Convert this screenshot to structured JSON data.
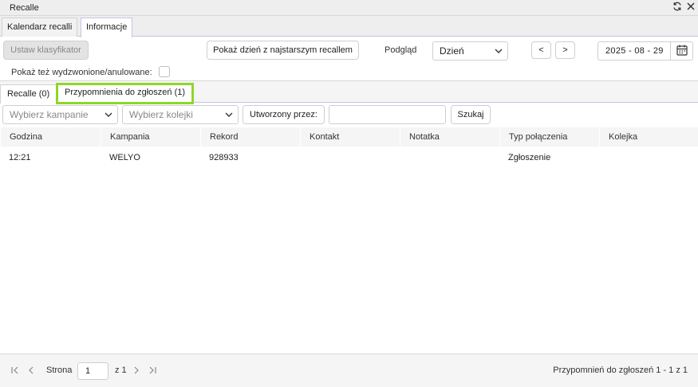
{
  "window": {
    "title": "Recalle",
    "refresh_icon": "refresh-icon",
    "close_icon": "close-icon"
  },
  "top_tabs": [
    {
      "label": "Kalendarz recalli",
      "active": false
    },
    {
      "label": "Informacje",
      "active": true
    }
  ],
  "toolbar": {
    "set_classifier_label": "Ustaw klasyfikator",
    "show_oldest_label": "Pokaż dzień z najstarszym recallem",
    "preview_label": "Podgląd",
    "preview_value": "Dzień",
    "prev_label": "<",
    "next_label": ">",
    "date_value": "2025 - 08 - 29",
    "show_cancelled_label": "Pokaż też wydzwonione/anulowane:",
    "show_cancelled_checked": false
  },
  "sub_tabs": [
    {
      "label": "Recalle (0)",
      "active": false
    },
    {
      "label": "Przypomnienia do zgłoszeń (1)",
      "active": true,
      "highlight_color": "#8fd62c"
    }
  ],
  "filters": {
    "campaign_placeholder": "Wybierz kampanie",
    "queue_placeholder": "Wybierz kolejki",
    "created_by_label": "Utworzony przez:",
    "search_value": "",
    "search_button": "Szukaj"
  },
  "table": {
    "columns": [
      "Godzina",
      "Kampania",
      "Rekord",
      "Kontakt",
      "Notatka",
      "Typ połączenia",
      "Kolejka"
    ],
    "rows": [
      [
        "12:21",
        "WELYO",
        "928933",
        "",
        "",
        "Zgłoszenie",
        ""
      ]
    ]
  },
  "pagination": {
    "page_label": "Strona",
    "page_value": "1",
    "of_label": "z 1",
    "summary": "Przypomnień do zgłoszeń 1 - 1 z 1"
  },
  "colors": {
    "accent_border": "#c9c3e6",
    "highlight": "#8fd62c"
  }
}
